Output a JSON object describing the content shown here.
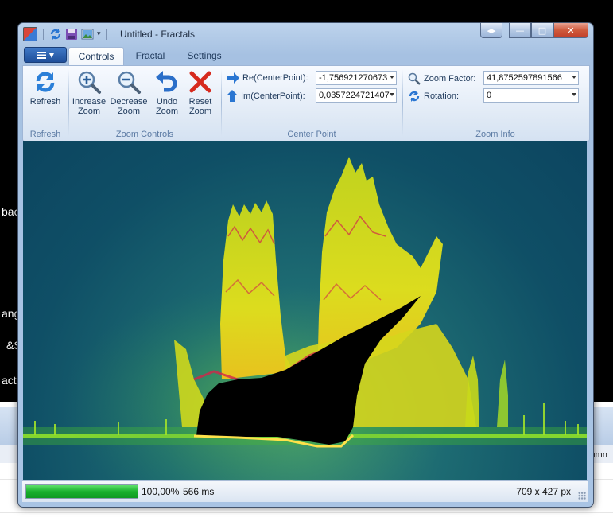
{
  "background_app": {
    "partial_texts": [
      "bac",
      "ang",
      "&S",
      "act"
    ],
    "column_text": "lumn"
  },
  "window": {
    "title": "Untitled - Fractals",
    "caption_buttons": {
      "back_forward": "◂▸",
      "minimize": "—",
      "maximize": "□",
      "close": "✕"
    }
  },
  "ribbon": {
    "app_menu_icon": "menu-icon",
    "tabs": [
      {
        "label": "Controls",
        "active": true
      },
      {
        "label": "Fractal",
        "active": false
      },
      {
        "label": "Settings",
        "active": false
      }
    ],
    "groups": {
      "refresh": {
        "label": "Refresh",
        "buttons": [
          {
            "label": "Refresh",
            "icon": "refresh-icon"
          }
        ]
      },
      "zoom_controls": {
        "label": "Zoom Controls",
        "buttons": [
          {
            "line1": "Increase",
            "line2": "Zoom",
            "icon": "zoom-in-icon"
          },
          {
            "line1": "Decrease",
            "line2": "Zoom",
            "icon": "zoom-out-icon"
          },
          {
            "line1": "Undo",
            "line2": "Zoom",
            "icon": "undo-icon"
          },
          {
            "line1": "Reset",
            "line2": "Zoom",
            "icon": "reset-icon"
          }
        ]
      },
      "center_point": {
        "label": "Center Point",
        "re_label": "Re(CenterPoint):",
        "re_value": "-1,756921270673",
        "im_label": "Im(CenterPoint):",
        "im_value": "0,0357224721407"
      },
      "zoom_info": {
        "label": "Zoom Info",
        "zoom_label": "Zoom Factor:",
        "zoom_value": "41,8752597891566",
        "rotation_label": "Rotation:",
        "rotation_value": "0"
      }
    }
  },
  "status_bar": {
    "progress": 1.0,
    "progress_text": "100,00%",
    "time_text": "566 ms",
    "size_text": "709 x 427 px"
  },
  "colors": {
    "fractal_yellow": "#e6e21a",
    "fractal_green": "#3fbf2a",
    "fractal_red": "#d2264a",
    "background_teal": "#0f4f66"
  }
}
